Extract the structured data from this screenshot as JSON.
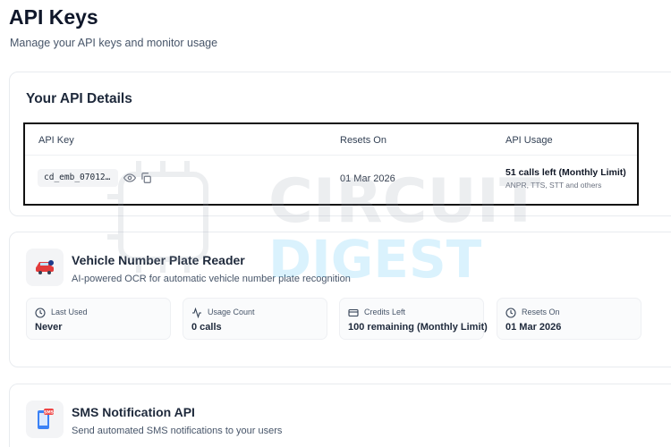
{
  "header": {
    "title": "API Keys",
    "subtitle": "Manage your API keys and monitor usage"
  },
  "details": {
    "title": "Your API Details",
    "columns": {
      "key": "API Key",
      "reset": "Resets On",
      "usage": "API Usage"
    },
    "row": {
      "key_masked": "cd_emb_07012…",
      "reset": "01 Mar 2026",
      "usage": "51 calls left (Monthly Limit)",
      "usage_sub": "ANPR, TTS, STT and others"
    }
  },
  "vehicle": {
    "icon": "car-icon",
    "title": "Vehicle Number Plate Reader",
    "desc": "AI-powered OCR for automatic vehicle number plate recognition",
    "stats": [
      {
        "icon": "clock-icon",
        "label": "Last Used",
        "value": "Never"
      },
      {
        "icon": "activity-icon",
        "label": "Usage Count",
        "value": "0 calls"
      },
      {
        "icon": "credit-card-icon",
        "label": "Credits Left",
        "value": "100 remaining (Monthly Limit)"
      },
      {
        "icon": "clock-icon",
        "label": "Resets On",
        "value": "01 Mar 2026"
      }
    ]
  },
  "sms": {
    "icon": "phone-sms-icon",
    "title": "SMS Notification API",
    "desc": "Send automated SMS notifications to your users"
  },
  "watermark": {
    "line1": "CIRCUIT",
    "line2": "DIGEST"
  },
  "colors": {
    "accent": "#111827",
    "car_red": "#e23b3b",
    "sms_red": "#ef4444",
    "border": "#e8ebef"
  }
}
